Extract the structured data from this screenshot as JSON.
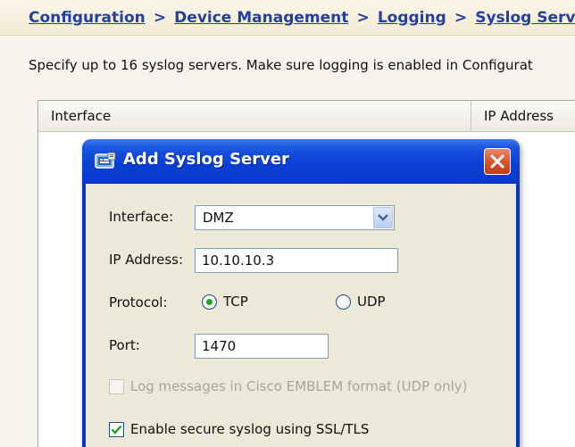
{
  "breadcrumb": {
    "items": [
      "Configuration",
      "Device Management",
      "Logging",
      "Syslog Servers"
    ],
    "separator": ">"
  },
  "description": "Specify up to 16 syslog servers. Make sure logging is enabled in Configurat",
  "table": {
    "columns": [
      "Interface",
      "IP Address"
    ]
  },
  "dialog": {
    "title": "Add Syslog Server",
    "interface": {
      "label": "Interface:",
      "value": "DMZ"
    },
    "ip_address": {
      "label": "IP Address:",
      "value": "10.10.10.3"
    },
    "protocol": {
      "label": "Protocol:",
      "options": [
        "TCP",
        "UDP"
      ],
      "selected": "TCP"
    },
    "port": {
      "label": "Port:",
      "value": "1470"
    },
    "emblem_checkbox": {
      "label": "Log messages in Cisco EMBLEM format (UDP only)",
      "checked": false,
      "disabled": true
    },
    "secure_checkbox": {
      "label": "Enable secure syslog using SSL/TLS",
      "checked": true,
      "disabled": false
    }
  },
  "colors": {
    "link": "#243fa4",
    "title_bar": "#0b3fd6",
    "dialog_body": "#ece9d8",
    "close_button": "#d8542e",
    "radio_selected": "#21a121",
    "check_mark": "#21a121",
    "disabled_text": "#a7a69b"
  },
  "icons": {
    "title": "syslog-server-icon",
    "close": "close-icon",
    "dropdown": "chevron-down-icon",
    "check": "checkmark-icon"
  }
}
